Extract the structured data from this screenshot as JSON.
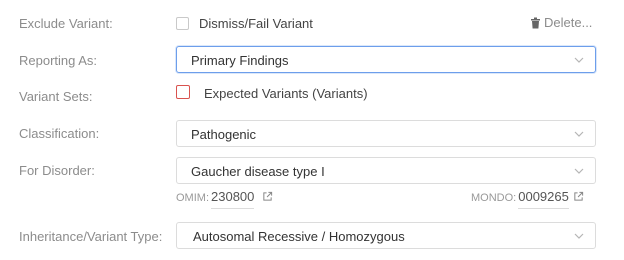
{
  "labels": {
    "exclude_variant": "Exclude Variant:",
    "reporting_as": "Reporting As:",
    "variant_sets": "Variant Sets:",
    "classification": "Classification:",
    "for_disorder": "For Disorder:",
    "inheritance": "Inheritance/Variant Type:"
  },
  "exclude": {
    "checkbox_label": "Dismiss/Fail Variant",
    "checked": false
  },
  "delete_label": "Delete...",
  "reporting_as": {
    "value": "Primary Findings"
  },
  "variant_sets": {
    "checkbox_label": "Expected Variants (Variants)",
    "checked": false
  },
  "classification": {
    "value": "Pathogenic"
  },
  "disorder": {
    "value": "Gaucher disease type I",
    "omim_prefix": "OMIM:",
    "omim_id": "230800",
    "mondo_prefix": "MONDO:",
    "mondo_id": "0009265"
  },
  "inheritance": {
    "value": "Autosomal Recessive / Homozygous"
  },
  "icons": {
    "delete": "trash-icon",
    "dropdown": "chevron-down-icon",
    "external": "external-link-icon"
  },
  "colors": {
    "focus_border": "#6d9eeb",
    "invalid_checkbox": "#d9534f"
  }
}
